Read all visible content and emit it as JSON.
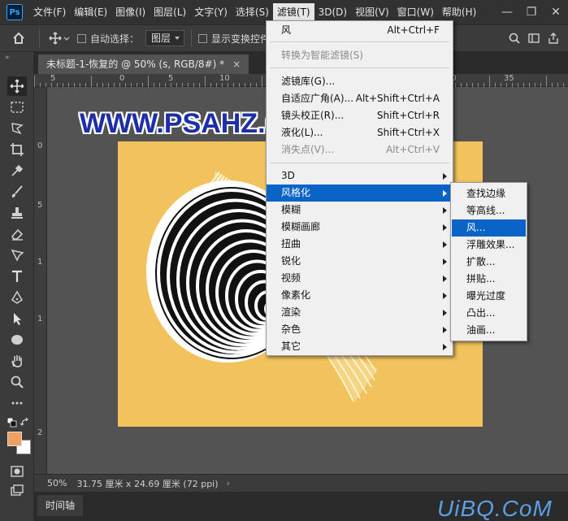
{
  "app": {
    "logo": "Ps"
  },
  "menubar": {
    "items": [
      "文件(F)",
      "编辑(E)",
      "图像(I)",
      "图层(L)",
      "文字(Y)",
      "选择(S)",
      "滤镜(T)",
      "3D(D)",
      "视图(V)",
      "窗口(W)",
      "帮助(H)"
    ],
    "active": "滤镜(T)",
    "window_controls": {
      "minimize": "—",
      "restore": "❐",
      "close": "✕"
    }
  },
  "options_bar": {
    "auto_select_label": "自动选择：",
    "layer_dropdown": "图层",
    "show_transform_label": "显示变换控件"
  },
  "document": {
    "tab_title": "未标题-1-恢复的 @ 50% (s, RGB/8#) *",
    "close_glyph": "×",
    "zoom": "50%",
    "doc_size": "31.75 厘米 x 24.69 厘米 (72 ppi)",
    "status_arrow": "›"
  },
  "rulers": {
    "top": [
      "5",
      "0",
      "5",
      "10",
      "15",
      "20",
      "25",
      "30",
      "35"
    ],
    "left": [
      "0",
      "5",
      "1",
      "1",
      "2"
    ]
  },
  "watermark": "WWW.PSAHZ.COM",
  "corner_logo": "UiBQ.CoM",
  "timeline_tab": "时间轴",
  "filter_menu": {
    "items": [
      {
        "label": "风",
        "shortcut": "Alt+Ctrl+F",
        "state": "normal"
      },
      {
        "label": "转换为智能滤镜(S)",
        "shortcut": "",
        "state": "disabled"
      },
      {
        "label": "滤镜库(G)...",
        "shortcut": "",
        "state": "normal"
      },
      {
        "label": "自适应广角(A)...",
        "shortcut": "Alt+Shift+Ctrl+A",
        "state": "normal"
      },
      {
        "label": "镜头校正(R)...",
        "shortcut": "Shift+Ctrl+R",
        "state": "normal"
      },
      {
        "label": "液化(L)...",
        "shortcut": "Shift+Ctrl+X",
        "state": "normal"
      },
      {
        "label": "消失点(V)...",
        "shortcut": "Alt+Ctrl+V",
        "state": "disabled"
      },
      {
        "label": "3D",
        "shortcut": "",
        "state": "submenu"
      },
      {
        "label": "风格化",
        "shortcut": "",
        "state": "submenu-highlight"
      },
      {
        "label": "模糊",
        "shortcut": "",
        "state": "submenu"
      },
      {
        "label": "模糊画廊",
        "shortcut": "",
        "state": "submenu"
      },
      {
        "label": "扭曲",
        "shortcut": "",
        "state": "submenu"
      },
      {
        "label": "锐化",
        "shortcut": "",
        "state": "submenu"
      },
      {
        "label": "视频",
        "shortcut": "",
        "state": "submenu"
      },
      {
        "label": "像素化",
        "shortcut": "",
        "state": "submenu"
      },
      {
        "label": "渲染",
        "shortcut": "",
        "state": "submenu"
      },
      {
        "label": "杂色",
        "shortcut": "",
        "state": "submenu"
      },
      {
        "label": "其它",
        "shortcut": "",
        "state": "submenu"
      }
    ]
  },
  "stylize_submenu": {
    "items": [
      "查找边缘",
      "等高线...",
      "风...",
      "浮雕效果...",
      "扩散...",
      "拼贴...",
      "曝光过度",
      "凸出...",
      "油画..."
    ],
    "highlighted": "风..."
  },
  "colors": {
    "artboard": "#f2c35c",
    "foreground_swatch": "#f0a060",
    "background_swatch": "#ffffff",
    "menu_highlight": "#0a64c8",
    "watermark": "#1c2fa8"
  },
  "tools": [
    "move-icon",
    "marquee-icon",
    "lasso-icon",
    "crop-icon",
    "eyedropper-icon",
    "brush-icon",
    "stamp-icon",
    "eraser-icon",
    "pen-path-icon",
    "type-icon",
    "pen-icon",
    "selection-arrow-icon",
    "ellipse-icon",
    "hand-icon",
    "zoom-icon",
    "more-icon"
  ]
}
